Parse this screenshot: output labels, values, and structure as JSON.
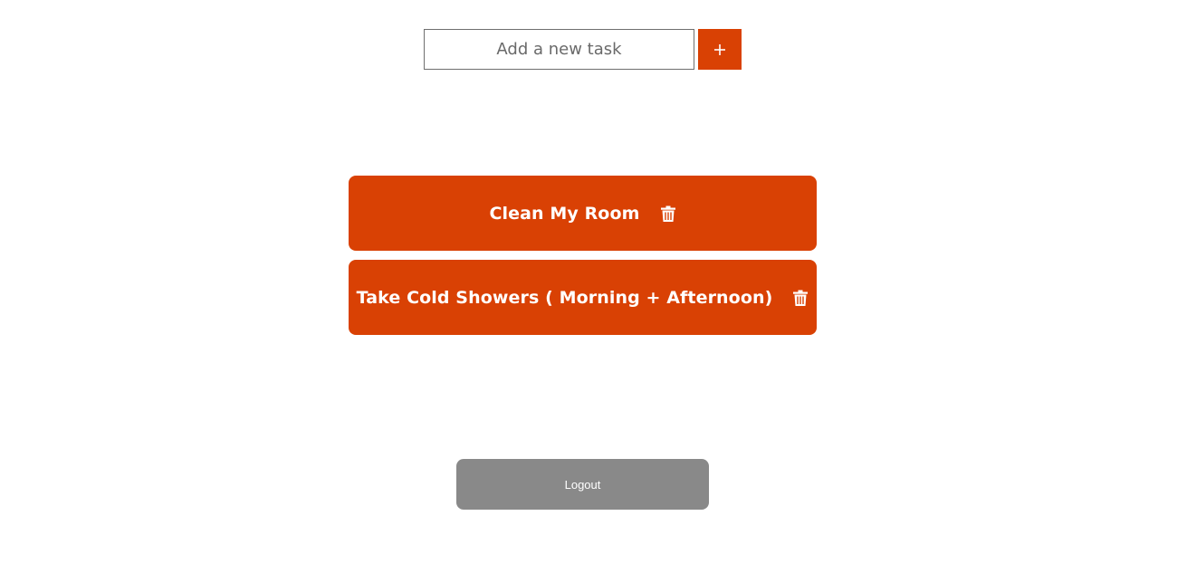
{
  "new_task": {
    "placeholder": "Add a new task",
    "value": "",
    "add_button_icon": "plus-icon"
  },
  "tasks": [
    {
      "text": "Clean My Room",
      "delete_icon": "trash-icon"
    },
    {
      "text": "Take Cold Showers ( Morning + Afternoon)",
      "delete_icon": "trash-icon"
    }
  ],
  "logout": {
    "label": "Logout"
  },
  "colors": {
    "accent": "#d94104",
    "logout_bg": "#898989",
    "background": "#ffffff"
  }
}
